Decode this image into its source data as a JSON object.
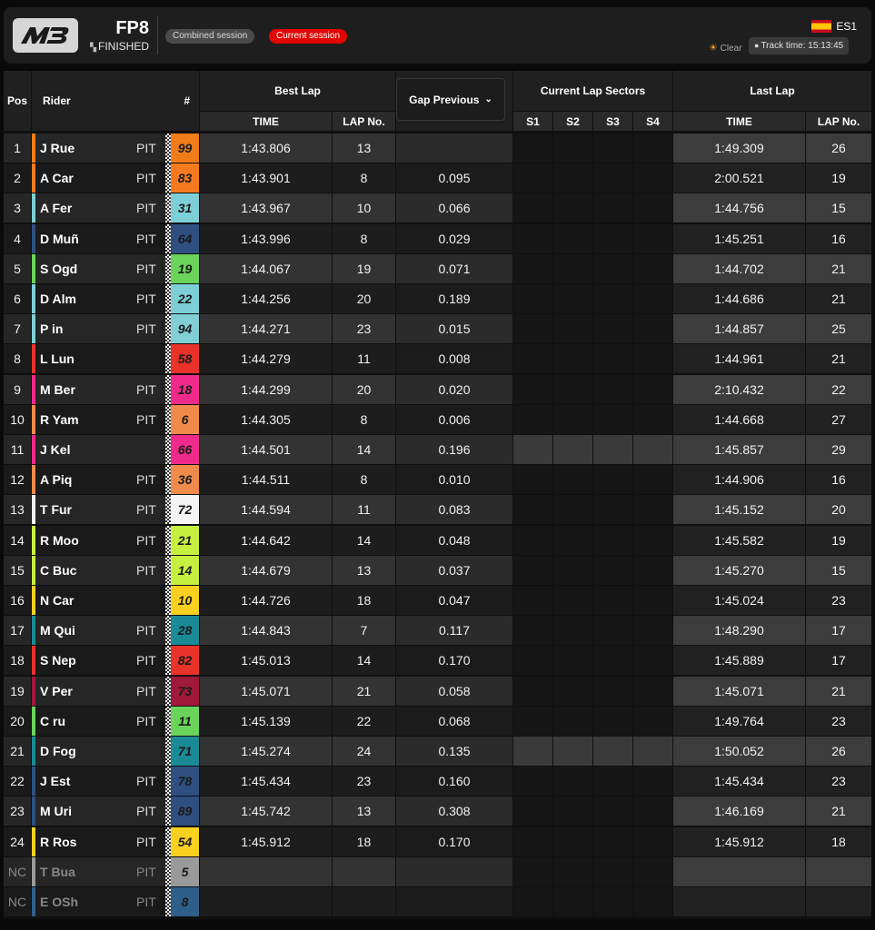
{
  "header": {
    "logo_text": "M3",
    "session_name": "FP8",
    "session_status": "FINISHED",
    "combined_label": "Combined session",
    "current_label": "Current session",
    "country_code": "ES1",
    "weather": "Clear",
    "track_time": "Track time: 15:13:45"
  },
  "columns": {
    "pos": "Pos",
    "rider": "Rider",
    "number": "#",
    "best_lap": "Best Lap",
    "best_time": "TIME",
    "best_lap_no": "LAP No.",
    "gap_previous": "Gap Previous",
    "sectors": "Current Lap Sectors",
    "s1": "S1",
    "s2": "S2",
    "s3": "S3",
    "s4": "S4",
    "last_lap": "Last Lap",
    "last_time": "TIME",
    "last_lap_no": "LAP No."
  },
  "rows": [
    {
      "pos": "1",
      "rider": "J Rue",
      "pit": "PIT",
      "no": "99",
      "color": "#f07d1a",
      "stripe": "#f07d1a",
      "best": "1:43.806",
      "best_lap": "13",
      "gap": "",
      "last": "1:49.309",
      "last_lap": "26",
      "lit": false
    },
    {
      "pos": "2",
      "rider": "A Car",
      "pit": "PIT",
      "no": "83",
      "color": "#f47a20",
      "stripe": "#f47a20",
      "best": "1:43.901",
      "best_lap": "8",
      "gap": "0.095",
      "last": "2:00.521",
      "last_lap": "19",
      "lit": false
    },
    {
      "pos": "3",
      "rider": "A Fer",
      "pit": "PIT",
      "no": "31",
      "color": "#7ccfd6",
      "stripe": "#7ccfd6",
      "best": "1:43.967",
      "best_lap": "10",
      "gap": "0.066",
      "last": "1:44.756",
      "last_lap": "15",
      "lit": false
    },
    {
      "pos": "4",
      "rider": "D Muñ",
      "pit": "PIT",
      "no": "64",
      "color": "#2e4f80",
      "stripe": "#2e4f80",
      "best": "1:43.996",
      "best_lap": "8",
      "gap": "0.029",
      "last": "1:45.251",
      "last_lap": "16",
      "lit": false
    },
    {
      "pos": "5",
      "rider": "S Ogd",
      "pit": "PIT",
      "no": "19",
      "color": "#6ad45a",
      "stripe": "#6ad45a",
      "best": "1:44.067",
      "best_lap": "19",
      "gap": "0.071",
      "last": "1:44.702",
      "last_lap": "21",
      "lit": false
    },
    {
      "pos": "6",
      "rider": "D Alm",
      "pit": "PIT",
      "no": "22",
      "color": "#7ccfd6",
      "stripe": "#7ccfd6",
      "best": "1:44.256",
      "best_lap": "20",
      "gap": "0.189",
      "last": "1:44.686",
      "last_lap": "21",
      "lit": false
    },
    {
      "pos": "7",
      "rider": "P in",
      "pit": "PIT",
      "no": "94",
      "color": "#7fcfd4",
      "stripe": "#7fcfd4",
      "best": "1:44.271",
      "best_lap": "23",
      "gap": "0.015",
      "last": "1:44.857",
      "last_lap": "25",
      "lit": false
    },
    {
      "pos": "8",
      "rider": "L Lun",
      "pit": "",
      "no": "58",
      "color": "#e8322a",
      "stripe": "#e8322a",
      "best": "1:44.279",
      "best_lap": "11",
      "gap": "0.008",
      "last": "1:44.961",
      "last_lap": "21",
      "lit": false
    },
    {
      "pos": "9",
      "rider": "M Ber",
      "pit": "PIT",
      "no": "18",
      "color": "#f02a8a",
      "stripe": "#f02a8a",
      "best": "1:44.299",
      "best_lap": "20",
      "gap": "0.020",
      "last": "2:10.432",
      "last_lap": "22",
      "lit": false
    },
    {
      "pos": "10",
      "rider": "R Yam",
      "pit": "PIT",
      "no": "6",
      "color": "#f08a4a",
      "stripe": "#f08a4a",
      "best": "1:44.305",
      "best_lap": "8",
      "gap": "0.006",
      "last": "1:44.668",
      "last_lap": "27",
      "lit": false
    },
    {
      "pos": "11",
      "rider": "J Kel",
      "pit": "",
      "no": "66",
      "color": "#f02a8a",
      "stripe": "#f02a8a",
      "best": "1:44.501",
      "best_lap": "14",
      "gap": "0.196",
      "last": "1:45.857",
      "last_lap": "29",
      "lit": true
    },
    {
      "pos": "12",
      "rider": "A Piq",
      "pit": "PIT",
      "no": "36",
      "color": "#f08a4a",
      "stripe": "#f08a4a",
      "best": "1:44.511",
      "best_lap": "8",
      "gap": "0.010",
      "last": "1:44.906",
      "last_lap": "16",
      "lit": false
    },
    {
      "pos": "13",
      "rider": "T Fur",
      "pit": "PIT",
      "no": "72",
      "color": "#f4f4f4",
      "stripe": "#f4f4f4",
      "best": "1:44.594",
      "best_lap": "11",
      "gap": "0.083",
      "last": "1:45.152",
      "last_lap": "20",
      "lit": false
    },
    {
      "pos": "14",
      "rider": "R Moo",
      "pit": "PIT",
      "no": "21",
      "color": "#c6f040",
      "stripe": "#c6f040",
      "best": "1:44.642",
      "best_lap": "14",
      "gap": "0.048",
      "last": "1:45.582",
      "last_lap": "19",
      "lit": false
    },
    {
      "pos": "15",
      "rider": "C Buc",
      "pit": "PIT",
      "no": "14",
      "color": "#c6f040",
      "stripe": "#c6f040",
      "best": "1:44.679",
      "best_lap": "13",
      "gap": "0.037",
      "last": "1:45.270",
      "last_lap": "15",
      "lit": false
    },
    {
      "pos": "16",
      "rider": "N Car",
      "pit": "",
      "no": "10",
      "color": "#f8d020",
      "stripe": "#f8d020",
      "best": "1:44.726",
      "best_lap": "18",
      "gap": "0.047",
      "last": "1:45.024",
      "last_lap": "23",
      "lit": false
    },
    {
      "pos": "17",
      "rider": "M Qui",
      "pit": "PIT",
      "no": "28",
      "color": "#1a8a96",
      "stripe": "#1a8a96",
      "best": "1:44.843",
      "best_lap": "7",
      "gap": "0.117",
      "last": "1:48.290",
      "last_lap": "17",
      "lit": false
    },
    {
      "pos": "18",
      "rider": "S Nep",
      "pit": "PIT",
      "no": "82",
      "color": "#e8322a",
      "stripe": "#e8322a",
      "best": "1:45.013",
      "best_lap": "14",
      "gap": "0.170",
      "last": "1:45.889",
      "last_lap": "17",
      "lit": false
    },
    {
      "pos": "19",
      "rider": "V Per",
      "pit": "PIT",
      "no": "73",
      "color": "#a0183a",
      "stripe": "#a0183a",
      "best": "1:45.071",
      "best_lap": "21",
      "gap": "0.058",
      "last": "1:45.071",
      "last_lap": "21",
      "lit": false
    },
    {
      "pos": "20",
      "rider": "C ru",
      "pit": "PIT",
      "no": "11",
      "color": "#6ad45a",
      "stripe": "#6ad45a",
      "best": "1:45.139",
      "best_lap": "22",
      "gap": "0.068",
      "last": "1:49.764",
      "last_lap": "23",
      "lit": false
    },
    {
      "pos": "21",
      "rider": "D Fog",
      "pit": "",
      "no": "71",
      "color": "#1a8a96",
      "stripe": "#1a8a96",
      "best": "1:45.274",
      "best_lap": "24",
      "gap": "0.135",
      "last": "1:50.052",
      "last_lap": "26",
      "lit": true
    },
    {
      "pos": "22",
      "rider": "J Est",
      "pit": "PIT",
      "no": "78",
      "color": "#2e4f80",
      "stripe": "#2e4f80",
      "best": "1:45.434",
      "best_lap": "23",
      "gap": "0.160",
      "last": "1:45.434",
      "last_lap": "23",
      "lit": false
    },
    {
      "pos": "23",
      "rider": "M Uri",
      "pit": "PIT",
      "no": "89",
      "color": "#2e4f80",
      "stripe": "#2e4f80",
      "best": "1:45.742",
      "best_lap": "13",
      "gap": "0.308",
      "last": "1:46.169",
      "last_lap": "21",
      "lit": false
    },
    {
      "pos": "24",
      "rider": "R Ros",
      "pit": "PIT",
      "no": "54",
      "color": "#f8d020",
      "stripe": "#f8d020",
      "best": "1:45.912",
      "best_lap": "18",
      "gap": "0.170",
      "last": "1:45.912",
      "last_lap": "18",
      "lit": false
    },
    {
      "pos": "NC",
      "rider": "T Bua",
      "pit": "PIT",
      "no": "5",
      "color": "#9a9a9a",
      "stripe": "#9a9a9a",
      "best": "",
      "best_lap": "",
      "gap": "",
      "last": "",
      "last_lap": "",
      "lit": false,
      "nc": true
    },
    {
      "pos": "NC",
      "rider": "E OSh",
      "pit": "PIT",
      "no": "8",
      "color": "#2e5f8a",
      "stripe": "#2e5f8a",
      "best": "",
      "best_lap": "",
      "gap": "",
      "last": "",
      "last_lap": "",
      "lit": false,
      "nc": true
    }
  ]
}
